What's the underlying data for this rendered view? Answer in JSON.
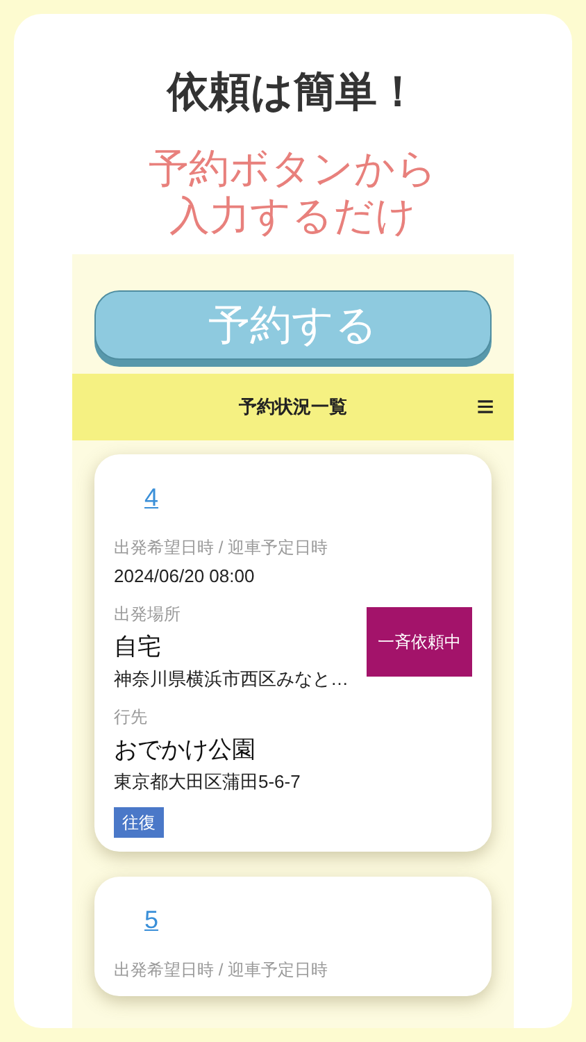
{
  "headline": "依頼は簡単！",
  "subheadline": [
    "予約ボタンから",
    "入力するだけ"
  ],
  "reserve_button": "予約する",
  "header": {
    "title": "予約状況一覧",
    "menu_icon": "≡"
  },
  "cards": [
    {
      "number": "4",
      "datetime_label": "出発希望日時 / 迎車予定日時",
      "datetime": "2024/06/20 08:00",
      "origin_label": "出発場所",
      "origin_name": "自宅",
      "origin_address": "神奈川県横浜市西区みなと…",
      "destination_label": "行先",
      "destination_name": "おでかけ公園",
      "destination_address": "東京都大田区蒲田5-6-7",
      "tag": "往復",
      "status": "一斉依頼中"
    },
    {
      "number": "5",
      "datetime_label": "出発希望日時 / 迎車予定日時"
    }
  ]
}
